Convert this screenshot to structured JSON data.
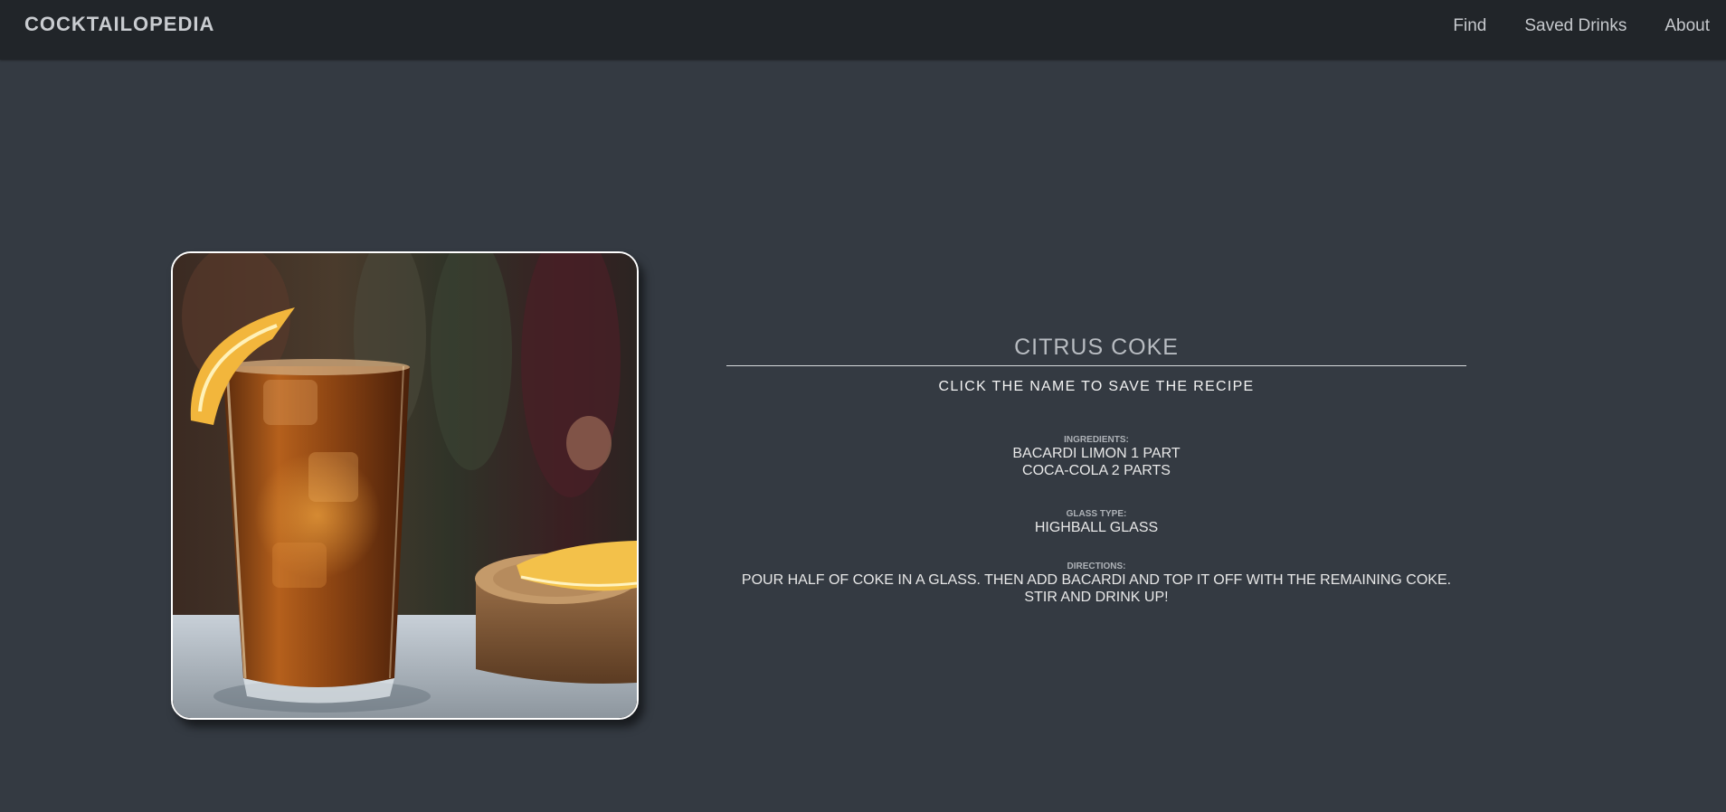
{
  "navbar": {
    "brand": "COCKTAILOPEDIA",
    "links": [
      "Find",
      "Saved Drinks",
      "About"
    ]
  },
  "drink": {
    "name": "CITRUS COKE",
    "save_hint": "CLICK THE NAME TO SAVE THE RECIPE",
    "ingredients_label": "INGREDIENTS:",
    "ingredients": [
      "BACARDI LIMON 1 PART",
      "COCA-COLA 2 PARTS"
    ],
    "glass_label": "GLASS TYPE:",
    "glass": "HIGHBALL GLASS",
    "directions_label": "DIRECTIONS:",
    "directions": [
      "POUR HALF OF COKE IN A GLASS. THEN ADD BACARDI AND TOP IT OFF WITH THE REMAINING COKE.",
      "STIR AND DRINK UP!"
    ]
  },
  "colors": {
    "page_background": "#343a42",
    "navbar_background": "#212529",
    "text": "#e3e3e3"
  }
}
